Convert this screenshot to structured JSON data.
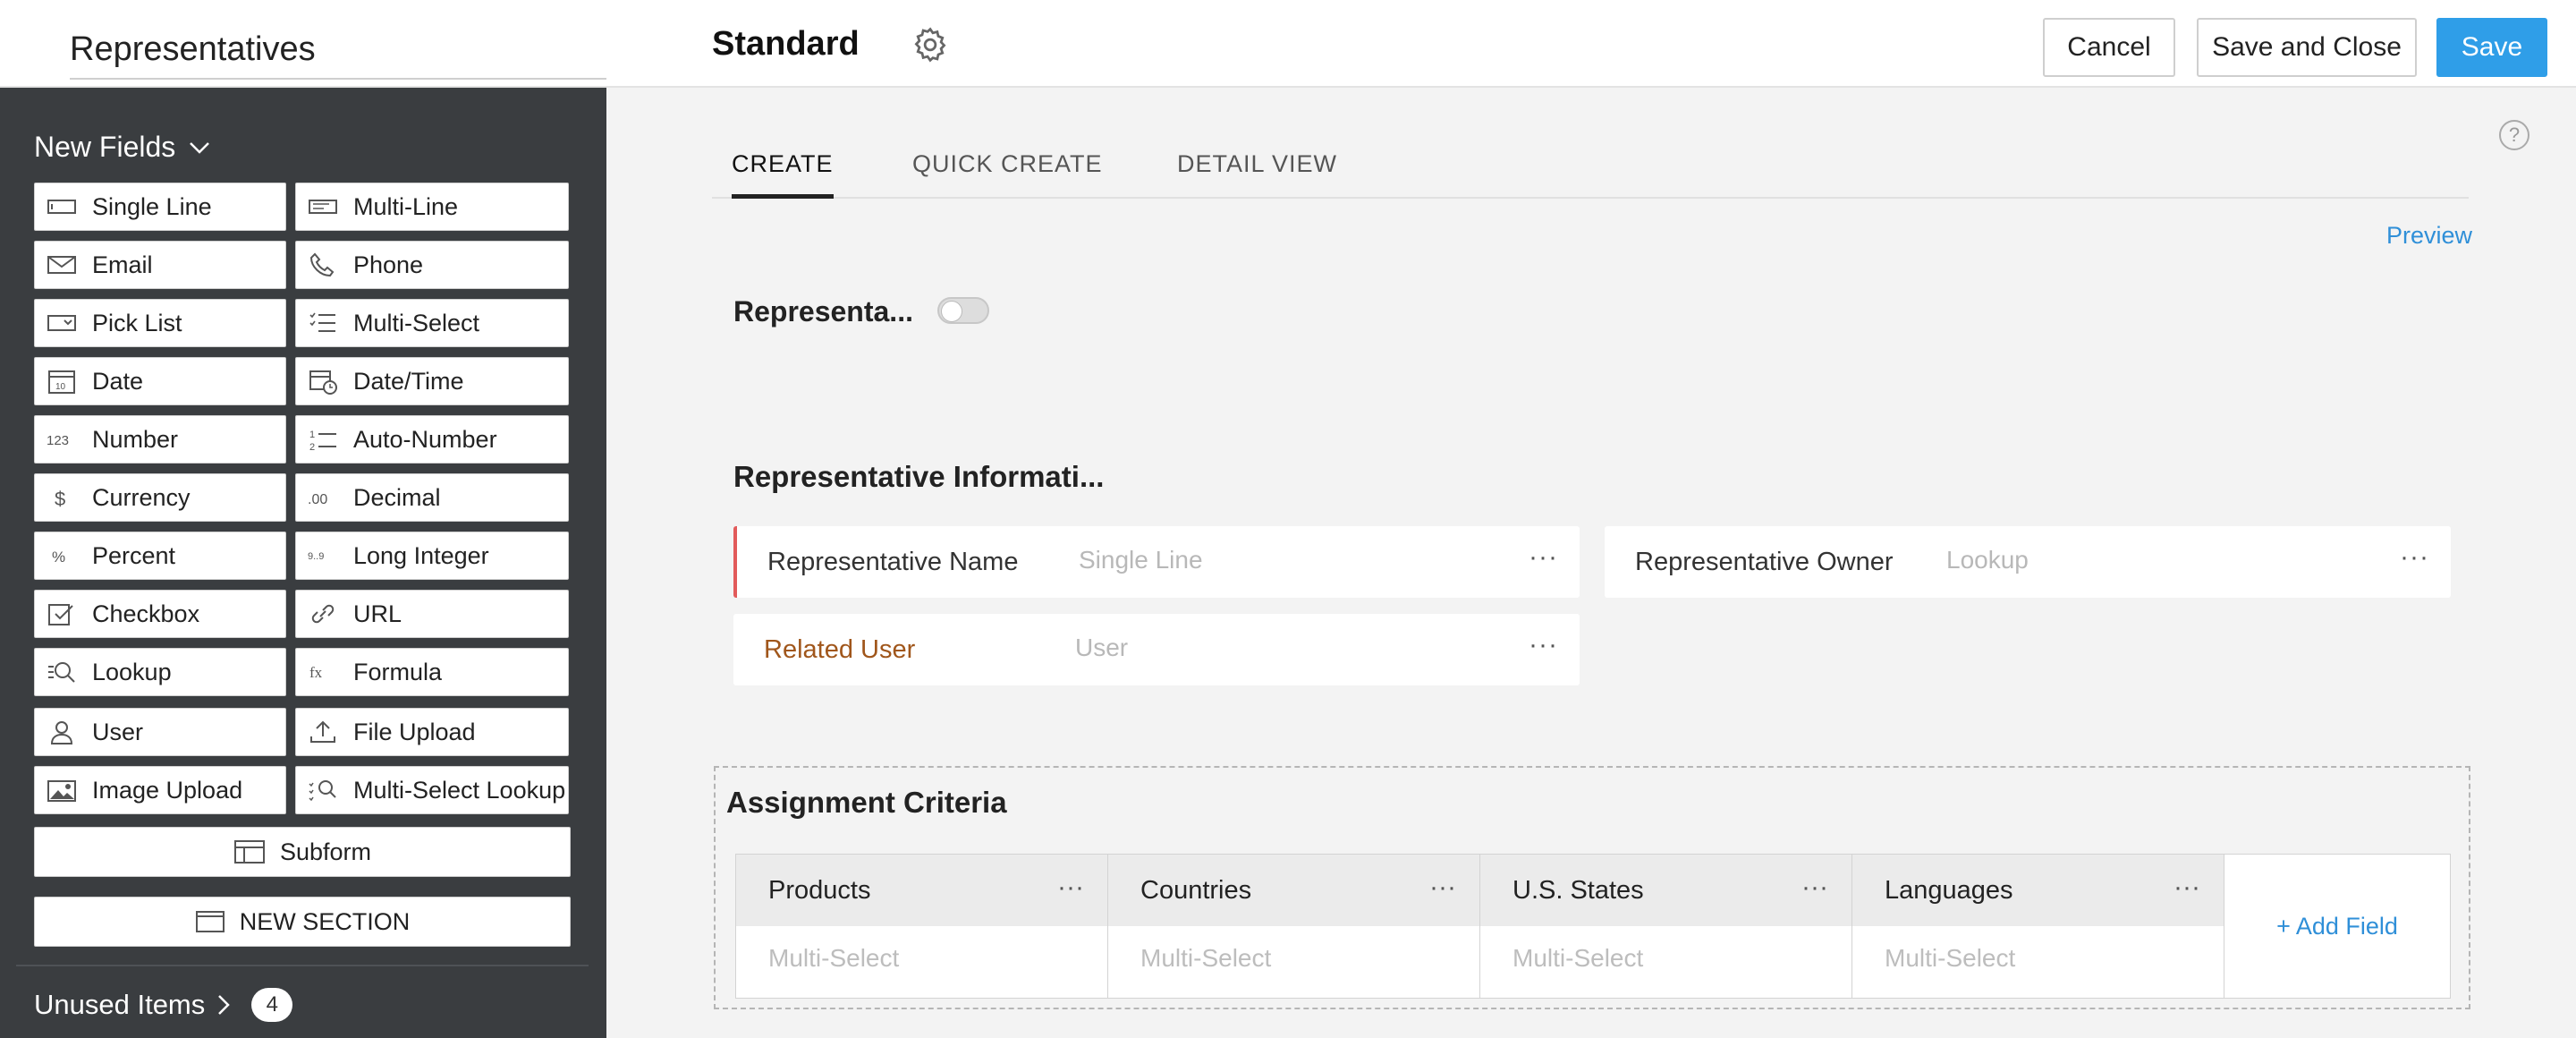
{
  "header": {
    "module_name": "Representatives",
    "layout_name": "Standard",
    "cancel_label": "Cancel",
    "save_close_label": "Save and Close",
    "save_label": "Save",
    "accent_color": "#2f9ee8"
  },
  "sidebar": {
    "new_fields_label": "New Fields",
    "fields": [
      {
        "label": "Single Line",
        "icon": "single-line-icon"
      },
      {
        "label": "Multi-Line",
        "icon": "multi-line-icon"
      },
      {
        "label": "Email",
        "icon": "email-icon"
      },
      {
        "label": "Phone",
        "icon": "phone-icon"
      },
      {
        "label": "Pick List",
        "icon": "pick-list-icon"
      },
      {
        "label": "Multi-Select",
        "icon": "multi-select-icon"
      },
      {
        "label": "Date",
        "icon": "date-icon"
      },
      {
        "label": "Date/Time",
        "icon": "date-time-icon"
      },
      {
        "label": "Number",
        "icon": "number-icon"
      },
      {
        "label": "Auto-Number",
        "icon": "auto-number-icon"
      },
      {
        "label": "Currency",
        "icon": "currency-icon"
      },
      {
        "label": "Decimal",
        "icon": "decimal-icon"
      },
      {
        "label": "Percent",
        "icon": "percent-icon"
      },
      {
        "label": "Long Integer",
        "icon": "long-integer-icon"
      },
      {
        "label": "Checkbox",
        "icon": "checkbox-icon"
      },
      {
        "label": "URL",
        "icon": "url-icon"
      },
      {
        "label": "Lookup",
        "icon": "lookup-icon"
      },
      {
        "label": "Formula",
        "icon": "formula-icon"
      },
      {
        "label": "User",
        "icon": "user-icon"
      },
      {
        "label": "File Upload",
        "icon": "file-upload-icon"
      },
      {
        "label": "Image Upload",
        "icon": "image-upload-icon"
      },
      {
        "label": "Multi-Select Lookup",
        "icon": "multi-select-lookup-icon"
      }
    ],
    "subform_label": "Subform",
    "new_section_label": "NEW SECTION",
    "unused_label": "Unused Items",
    "unused_count": "4"
  },
  "main": {
    "tabs": [
      {
        "label": "CREATE",
        "active": true
      },
      {
        "label": "QUICK CREATE",
        "active": false
      },
      {
        "label": "DETAIL VIEW",
        "active": false
      }
    ],
    "preview_label": "Preview",
    "rep_title": "Representa...",
    "toggle_on": false,
    "section_title": "Representative Informati...",
    "fields": {
      "rep_name": {
        "label": "Representative Name",
        "type": "Single Line"
      },
      "rep_owner": {
        "label": "Representative Owner",
        "type": "Lookup"
      },
      "related_user": {
        "label": "Related User",
        "type": "User"
      }
    },
    "more_glyph": "···",
    "assignment": {
      "title": "Assignment Criteria",
      "columns": [
        {
          "header": "Products",
          "value": "Multi-Select"
        },
        {
          "header": "Countries",
          "value": "Multi-Select"
        },
        {
          "header": "U.S. States",
          "value": "Multi-Select"
        },
        {
          "header": "Languages",
          "value": "Multi-Select"
        }
      ],
      "add_field_label": "+ Add Field"
    }
  }
}
